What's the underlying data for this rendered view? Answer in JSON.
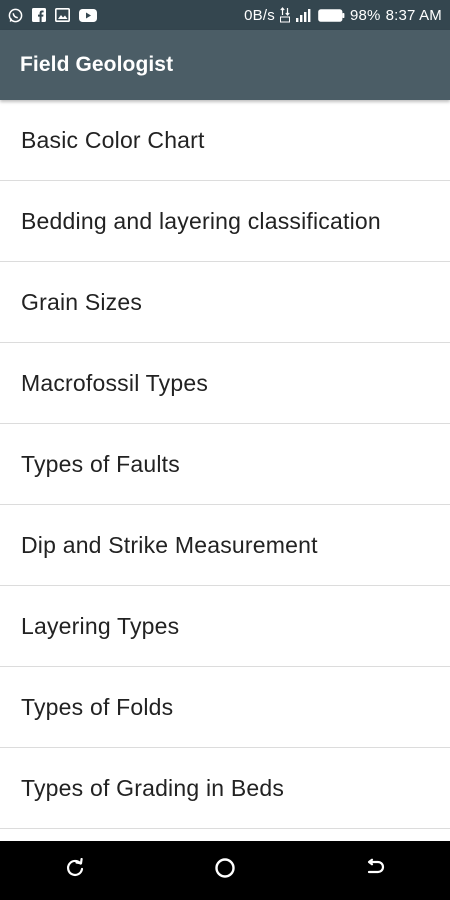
{
  "status_bar": {
    "network_speed": "0B/s",
    "battery": "98%",
    "time": "8:37 AM",
    "icons": [
      "whatsapp-icon",
      "facebook-icon",
      "gallery-icon",
      "youtube-icon",
      "data-icon",
      "signal-icon",
      "battery-icon"
    ]
  },
  "app_bar": {
    "title": "Field Geologist"
  },
  "list": {
    "items": [
      {
        "label": "Basic Color Chart"
      },
      {
        "label": "Bedding and layering classification"
      },
      {
        "label": "Grain Sizes"
      },
      {
        "label": "Macrofossil Types"
      },
      {
        "label": "Types of Faults"
      },
      {
        "label": "Dip and Strike Measurement"
      },
      {
        "label": "Layering Types"
      },
      {
        "label": "Types of Folds"
      },
      {
        "label": "Types of Grading in Beds"
      }
    ]
  },
  "nav_bar": {
    "buttons": [
      "recent-apps-icon",
      "home-icon",
      "back-icon"
    ]
  },
  "colors": {
    "status_bar": "#34464f",
    "app_bar": "#4b5d66",
    "divider": "#dcdcdc",
    "nav_bar": "#000000"
  }
}
